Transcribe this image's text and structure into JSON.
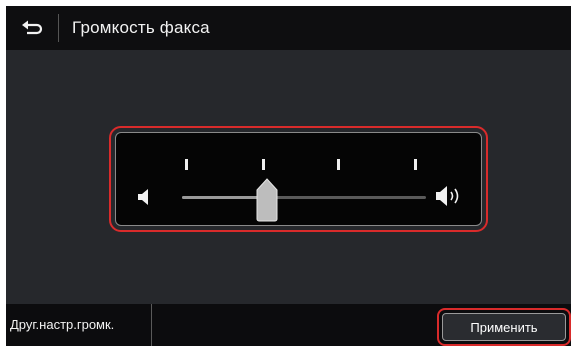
{
  "window": {
    "title": "Громкость факса"
  },
  "icons": {
    "back": "back-arrow-icon",
    "volume_min": "speaker-low-icon",
    "volume_max": "speaker-high-icon"
  },
  "volume": {
    "tick_count": 4,
    "level_fraction": 0.35
  },
  "footer": {
    "other_settings_label": "Друг.настр.громк.",
    "apply_label": "Применить"
  },
  "colors": {
    "highlight": "#d92b2b",
    "background": "#26282c",
    "bar": "#0e0e10"
  }
}
